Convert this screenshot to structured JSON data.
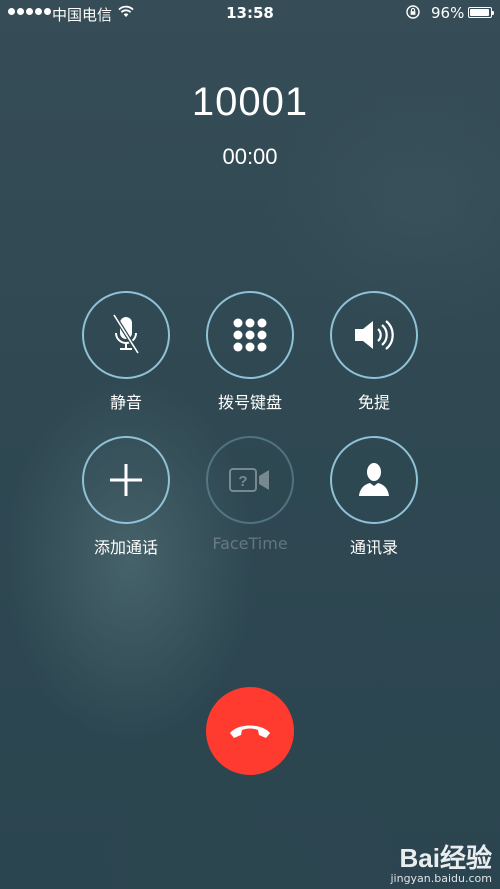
{
  "status_bar": {
    "carrier": "中国电信",
    "time": "13:58",
    "battery_pct": "96%",
    "battery_level": 0.96
  },
  "call": {
    "number": "10001",
    "duration": "00:00"
  },
  "controls": [
    {
      "label": "静音",
      "icon": "mic-muted-icon",
      "enabled": true
    },
    {
      "label": "拨号键盘",
      "icon": "keypad-icon",
      "enabled": true
    },
    {
      "label": "免提",
      "icon": "speaker-icon",
      "enabled": true
    },
    {
      "label": "添加通话",
      "icon": "plus-icon",
      "enabled": true
    },
    {
      "label": "FaceTime",
      "icon": "facetime-icon",
      "enabled": false
    },
    {
      "label": "通讯录",
      "icon": "contact-icon",
      "enabled": true
    }
  ],
  "end_call": {
    "icon": "end-call-icon",
    "color": "#ff3b30"
  },
  "colors": {
    "accent_ring": "#8fc2d6"
  },
  "watermark": {
    "logo": "Bai经验",
    "url": "jingyan.baidu.com"
  }
}
